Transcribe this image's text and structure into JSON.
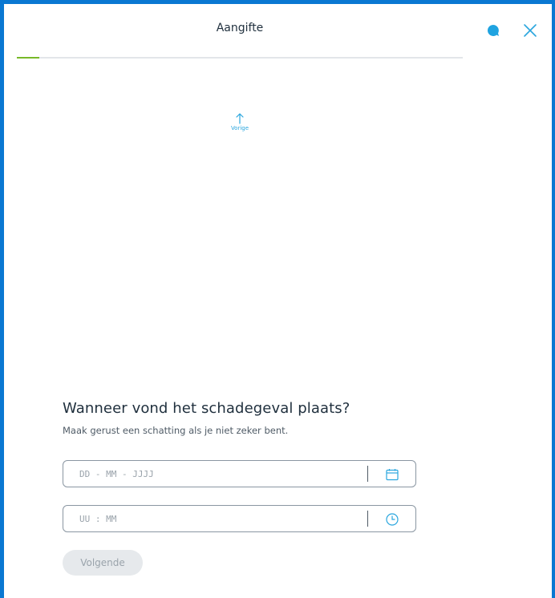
{
  "header": {
    "title": "Aangifte",
    "chat_icon": "chat-bubble-icon",
    "close_icon": "close-icon"
  },
  "progress": {
    "value_fraction": 0.05,
    "color": "#78b928"
  },
  "navigation": {
    "previous_label": "Vorige",
    "previous_icon": "arrow-up-icon"
  },
  "question": {
    "title": "Wanneer vond het schadegeval plaats?",
    "hint": "Maak gerust een schatting als je niet zeker bent."
  },
  "date_field": {
    "placeholder": "DD - MM - JJJJ",
    "value": "",
    "icon": "calendar-icon"
  },
  "time_field": {
    "placeholder": "UU : MM",
    "value": "",
    "icon": "clock-icon"
  },
  "actions": {
    "next_label": "Volgende"
  },
  "colors": {
    "accent": "#2aa6de",
    "frame": "#0a78d2",
    "text": "#1f2f3d"
  }
}
